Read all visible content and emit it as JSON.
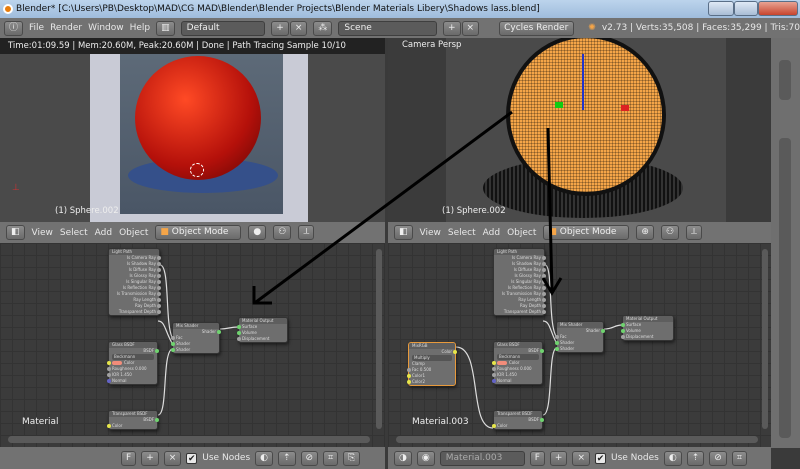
{
  "window": {
    "title": "Blender* [C:\\Users\\PB\\Desktop\\MAD\\CG MAD\\Blender\\Blender Projects\\Blender Materials Libery\\Shadows lass.blend]"
  },
  "menubar": {
    "items": [
      "File",
      "Render",
      "Window",
      "Help"
    ],
    "layout": "Default",
    "scene": "Scene",
    "engine": "Cycles Render",
    "stats": "v2.73 | Verts:35,508 | Faces:35,299 | Tris:70"
  },
  "left_view": {
    "render_status": "Time:01:09.59 | Mem:20.60M, Peak:20.60M | Done | Path Tracing Sample 10/10",
    "object_label": "(1) Sphere.002"
  },
  "right_view": {
    "view_label": "Camera Persp",
    "object_label": "(1) Sphere.002"
  },
  "view_header": {
    "menus": [
      "View",
      "Select",
      "Add",
      "Object"
    ],
    "mode": "Object Mode"
  },
  "left_nodes": {
    "material_label": "Material"
  },
  "right_nodes": {
    "material_label": "Material.003"
  },
  "footer": {
    "use_nodes": "Use Nodes",
    "use_nodes_checked": true,
    "material_name": "Material.003",
    "fake_user": "F"
  },
  "nodes": {
    "light_path": {
      "title": "Light Path",
      "outputs": [
        "Is Camera Ray",
        "Is Shadow Ray",
        "Is Diffuse Ray",
        "Is Glossy Ray",
        "Is Singular Ray",
        "Is Reflection Ray",
        "Is Transmission Ray",
        "Ray Length",
        "Ray Depth",
        "Transparent Depth"
      ]
    },
    "glass": {
      "title": "Glass BSDF",
      "output": "BSDF",
      "distribution": "Beckmann",
      "inputs": [
        "Color",
        "Roughness 0.000",
        "IOR 1.450",
        "Normal"
      ]
    },
    "mix": {
      "title": "Mix Shader",
      "output": "Shader",
      "inputs": [
        "Fac",
        "Shader",
        "Shader"
      ]
    },
    "output": {
      "title": "Material Output",
      "inputs": [
        "Surface",
        "Volume",
        "Displacement"
      ]
    },
    "transparent": {
      "title": "Transparent BSDF",
      "output": "BSDF",
      "inputs": [
        "Color"
      ]
    },
    "mixrgb": {
      "title": "MixRGB",
      "output": "Color",
      "blend": "Multiply",
      "clamp": "Clamp",
      "inputs": [
        "Fac 0.500",
        "Color1",
        "Color2"
      ]
    }
  },
  "colors": {
    "accent_orange": "#f5a548",
    "selected_node": "#e89a3c",
    "socket_shader": "#6fd36f",
    "socket_color": "#e6e64a",
    "socket_value": "#a1a1a1",
    "swatch": "#f28c7a"
  }
}
